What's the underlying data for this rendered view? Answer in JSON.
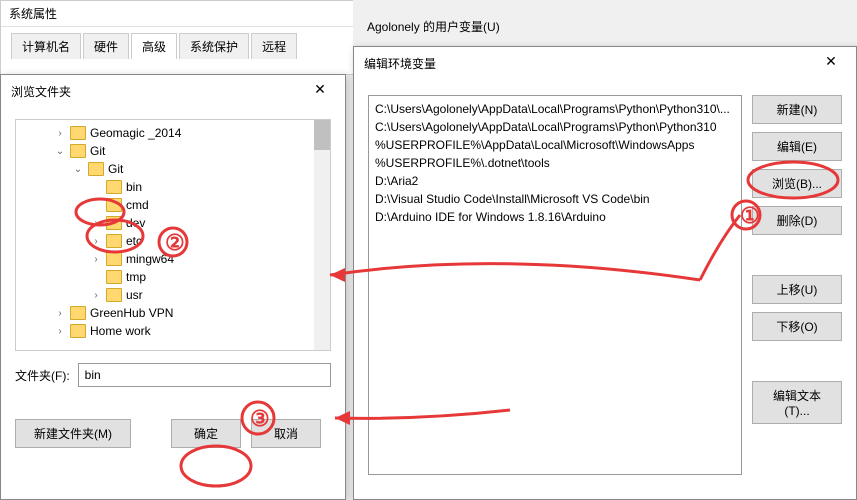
{
  "sysprops": {
    "title": "系统属性",
    "tabs": [
      "计算机名",
      "硬件",
      "高级",
      "系统保护",
      "远程"
    ],
    "activeTab": 2
  },
  "browse": {
    "title": "浏览文件夹",
    "tree": [
      {
        "depth": 1,
        "expand": "›",
        "label": "Geomagic _2014"
      },
      {
        "depth": 1,
        "expand": "⌄",
        "label": "Git"
      },
      {
        "depth": 2,
        "expand": "⌄",
        "label": "Git"
      },
      {
        "depth": 3,
        "expand": "",
        "label": "bin"
      },
      {
        "depth": 3,
        "expand": "",
        "label": "cmd"
      },
      {
        "depth": 3,
        "expand": "›",
        "label": "dev"
      },
      {
        "depth": 3,
        "expand": "›",
        "label": "etc"
      },
      {
        "depth": 3,
        "expand": "›",
        "label": "mingw64"
      },
      {
        "depth": 3,
        "expand": "",
        "label": "tmp"
      },
      {
        "depth": 3,
        "expand": "›",
        "label": "usr"
      },
      {
        "depth": 1,
        "expand": "›",
        "label": "GreenHub VPN"
      },
      {
        "depth": 1,
        "expand": "›",
        "label": "Home work"
      }
    ],
    "folderLabel": "文件夹(F):",
    "folderValue": "bin",
    "newFolder": "新建文件夹(M)",
    "ok": "确定",
    "cancel": "取消"
  },
  "env": {
    "userVarsHeader": "Agolonely 的用户变量(U)",
    "editTitle": "编辑环境变量",
    "paths": [
      "C:\\Users\\Agolonely\\AppData\\Local\\Programs\\Python\\Python310\\...",
      "C:\\Users\\Agolonely\\AppData\\Local\\Programs\\Python\\Python310",
      "%USERPROFILE%\\AppData\\Local\\Microsoft\\WindowsApps",
      "%USERPROFILE%\\.dotnet\\tools",
      "D:\\Aria2",
      "D:\\Visual Studio Code\\Install\\Microsoft VS Code\\bin",
      "D:\\Arduino IDE for Windows 1.8.16\\Arduino"
    ],
    "buttons": {
      "new": "新建(N)",
      "edit": "编辑(E)",
      "browse": "浏览(B)...",
      "delete": "删除(D)",
      "moveUp": "上移(U)",
      "moveDown": "下移(O)",
      "editText": "编辑文本(T)..."
    }
  },
  "annotations": {
    "one": "①",
    "two": "②",
    "three": "③"
  }
}
